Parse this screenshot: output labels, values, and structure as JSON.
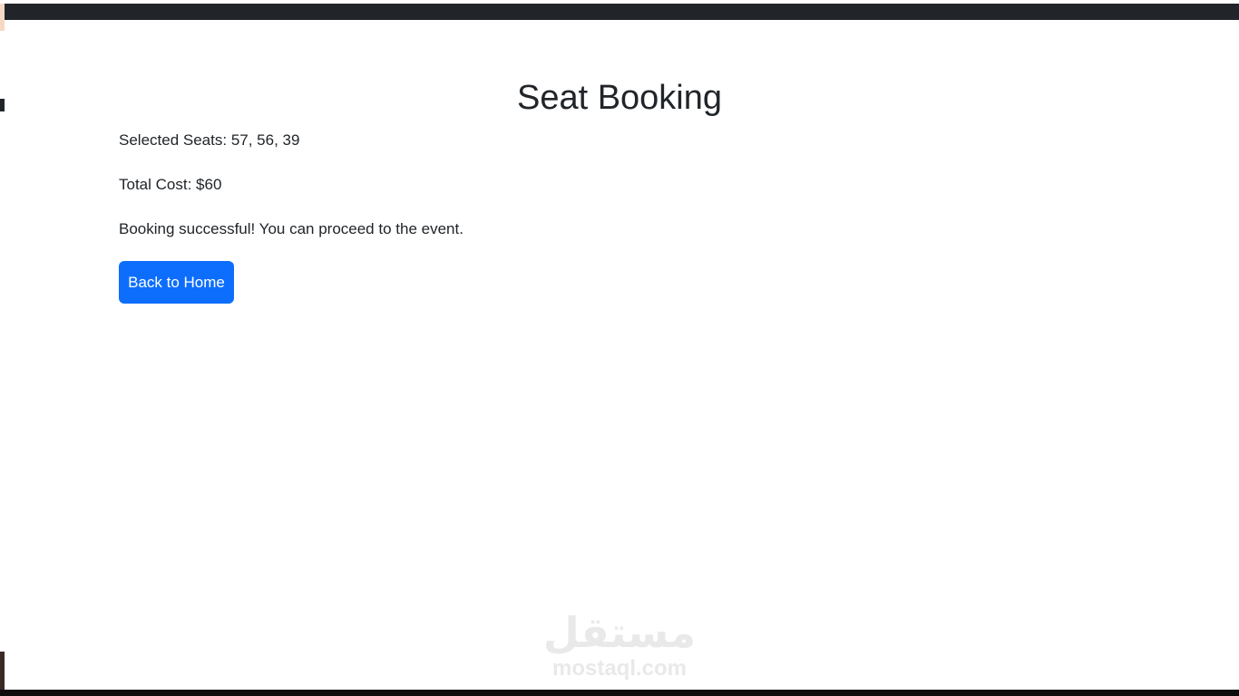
{
  "header": {
    "title": "Seat Booking"
  },
  "booking": {
    "selected_seats_label": "Selected Seats:",
    "selected_seats": [
      "57",
      "56",
      "39"
    ],
    "selected_seats_text": "57, 56, 39",
    "total_cost_label": "Total Cost:",
    "total_cost": "$60",
    "message": "Booking successful! You can proceed to the event."
  },
  "actions": {
    "back_home_label": "Back to Home"
  },
  "watermark": {
    "arabic_text": "مستقل",
    "site_text": "mostaql.com"
  },
  "colors": {
    "primary_button": "#0d6efd",
    "top_bar": "#212529",
    "text": "#212529",
    "watermark": "#e9e9e9"
  }
}
